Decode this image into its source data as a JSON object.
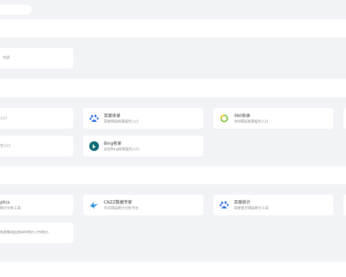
{
  "search": {
    "placeholder": ""
  },
  "sections": {
    "top": {
      "cards": [
        {
          "title": "",
          "desc": "可调"
        }
      ]
    },
    "submission": {
      "cards": [
        {
          "title": "",
          "desc": "入口"
        },
        {
          "title": "百度收录",
          "desc": "百度网站收录提交入口",
          "icon": "baidu-paw-icon"
        },
        {
          "title": "360收录",
          "desc": "360网站收录提交入口",
          "icon": "360-ring-icon"
        },
        {
          "title": "",
          "desc": "交入口"
        },
        {
          "title": "Bing收录",
          "desc": "必应Bing收录提交入口",
          "icon": "bing-icon"
        }
      ]
    },
    "analytics": {
      "cards": [
        {
          "title": "ytics",
          "desc": "统计分析工具"
        },
        {
          "title": "CNZZ数据专家",
          "desc": "中文网站统计分析平台",
          "icon": "cnzz-bird-icon"
        },
        {
          "title": "百度统计",
          "desc": "百度官方网站统计工具",
          "icon": "baidu-paw-icon"
        },
        {
          "title": "",
          "desc": "免费移动应用APP统计| H5统计。"
        }
      ]
    }
  },
  "colors": {
    "baidu": "#2f6fe0",
    "ring": "#7cc43a",
    "bing": "#0b6a73",
    "cnzz": "#2b8de0"
  }
}
